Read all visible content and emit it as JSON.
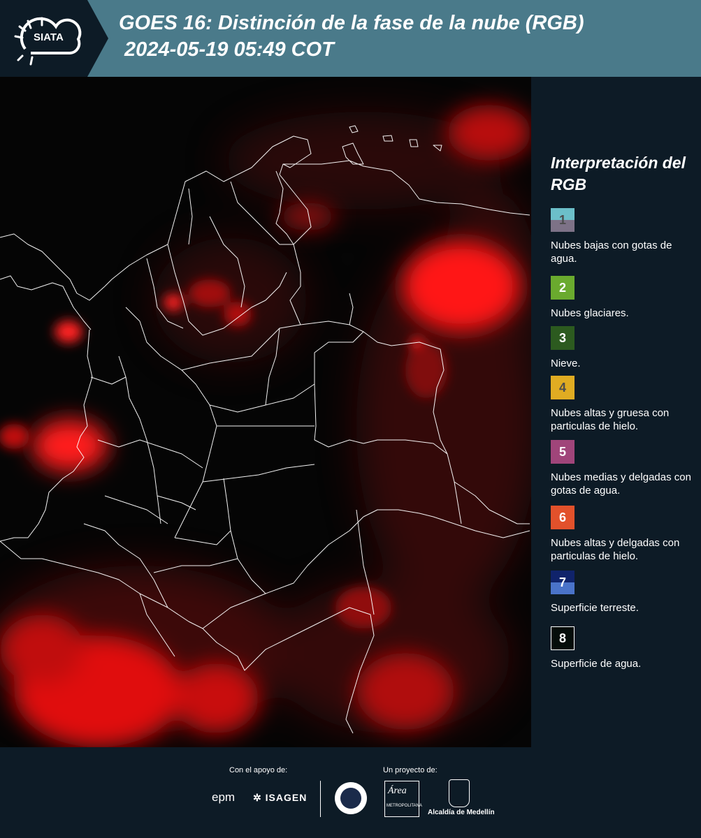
{
  "header": {
    "logo": "SIATA",
    "title_line1": "GOES 16: Distinción de la fase de la nube (RGB)",
    "title_line2": " 2024-05-19 05:49 COT"
  },
  "legend": {
    "title": "Interpretación del RGB",
    "items": [
      {
        "num": "1",
        "label": "Nubes bajas con gotas de agua.",
        "top_color": "#6cbfc9",
        "bottom_color": "#7d7287",
        "num_color": "#4d4d4d"
      },
      {
        "num": "2",
        "label": "Nubes glaciares.",
        "top_color": "#6aaa2e",
        "bottom_color": "#6aaa2e",
        "num_color": "#ffffff"
      },
      {
        "num": "3",
        "label": "Nieve.",
        "top_color": "#2c5a1f",
        "bottom_color": "#2c5a1f",
        "num_color": "#ffffff"
      },
      {
        "num": "4",
        "label": "Nubes altas y gruesa con particulas de hielo.",
        "top_color": "#e0ac22",
        "bottom_color": "#e0ac22",
        "num_color": "#4d4d4d"
      },
      {
        "num": "5",
        "label": "Nubes medias y delgadas con gotas de agua.",
        "top_color": "#a0457a",
        "bottom_color": "#a0457a",
        "num_color": "#ffffff"
      },
      {
        "num": "6",
        "label": "Nubes altas y delgadas con particulas de hielo.",
        "top_color": "#e2512b",
        "bottom_color": "#e2512b",
        "num_color": "#ffffff"
      },
      {
        "num": "7",
        "label": "Superficie terreste.",
        "top_color": "#10236b",
        "bottom_color": "#4a73c9",
        "num_color": "#ffffff"
      },
      {
        "num": "8",
        "label": "Superficie de agua.",
        "top_color": "#050d0a",
        "bottom_color": "#050d0a",
        "num_color": "#ffffff"
      }
    ]
  },
  "footer": {
    "support_label": "Con el apoyo de:",
    "project_label": "Un proyecto de:",
    "sponsor_epm": "epm",
    "sponsor_isagen": "ISAGEN",
    "area_text": "Área",
    "area_sub": "METROPOLITANA",
    "alcaldia": "Alcaldía de Medellín"
  }
}
